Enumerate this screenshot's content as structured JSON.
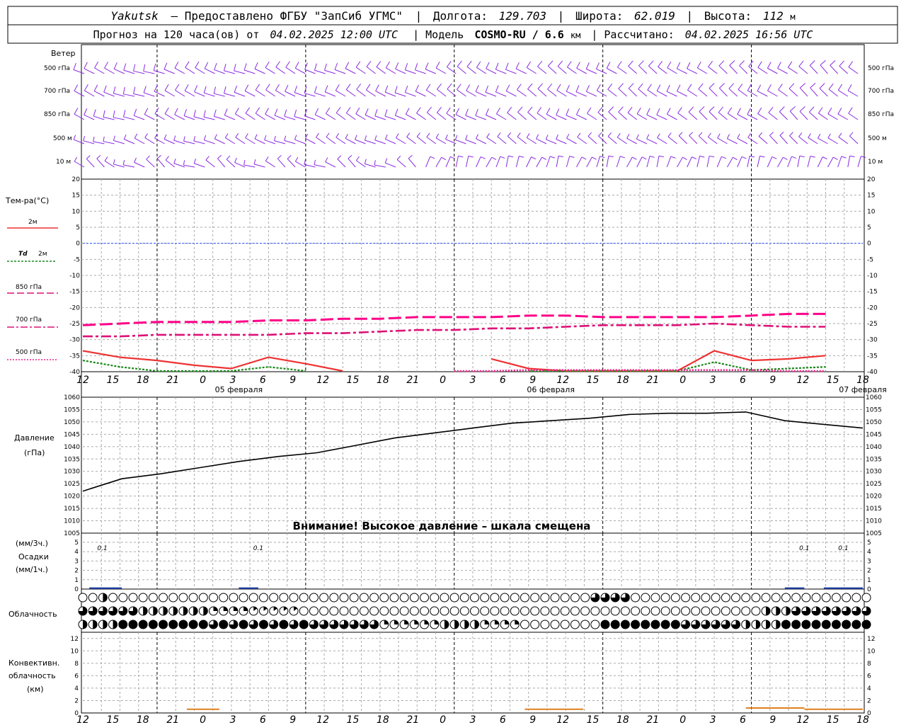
{
  "header": {
    "station": "Yakutsk",
    "provider": "— Предоставлено ФГБУ \"ЗапСиб УГМС\"",
    "lon_label": "Долгота:",
    "lon": "129.703",
    "lat_label": "Широта:",
    "lat": "62.019",
    "alt_label": "Высота:",
    "alt": "112",
    "alt_unit": "м",
    "line2_a": "Прогноз на 120 часа(ов) от",
    "run": "04.02.2025 12:00 UTC",
    "model_label": "| Модель",
    "model": "COSMO-RU / 6.6",
    "model_unit": "км",
    "calc_label": "| Рассчитано:",
    "calc": "04.02.2025 16:56 UTC"
  },
  "labels": {
    "wind": "Ветер",
    "temp": "Тем-ра(°С)",
    "t2m": "2м",
    "td": "Td",
    "td2m": "2м",
    "l850": "850 гПа",
    "l700": "700 гПа",
    "l500": "500 гПа",
    "pressure1": "Давление",
    "pressure2": "(гПа)",
    "precip1": "(мм/3ч.)",
    "precip2": "Осадки",
    "precip3": "(мм/1ч.)",
    "cloud": "Облачность",
    "conv1": "Конвективн.",
    "conv2": "облачность",
    "conv3": "(км)",
    "warning": "Внимание! Высокое давление – шкала смещена"
  },
  "colors": {
    "wind": "#8a2be2",
    "t2m": "#ee3333",
    "td": "#1a8a1a",
    "t850": "#ff0088",
    "t700": "#dd1177",
    "t500": "#ee2288",
    "zero": "#3355ff",
    "pressure": "#000000",
    "precip": "#1a3a9a",
    "conv": "#e08020"
  },
  "chart_data": [
    {
      "type": "line",
      "title": "Ветер",
      "levels": [
        "500 гПа",
        "700 гПа",
        "850 гПа",
        "500 м",
        "10 м"
      ]
    },
    {
      "type": "line",
      "ylabel": "Тем-ра(°С)",
      "ylim": [
        -40,
        20
      ],
      "yticks": [
        20,
        15,
        10,
        5,
        0,
        -5,
        -10,
        -15,
        -20,
        -25,
        -30,
        -35,
        -40
      ],
      "x_hours": [
        0,
        6,
        12,
        18,
        24,
        30,
        36,
        42,
        48,
        54,
        60,
        66,
        72,
        78,
        84,
        90,
        96,
        102,
        108,
        114,
        120
      ],
      "series": [
        {
          "name": "2м",
          "values": [
            -33.5,
            -35.5,
            -36.5,
            -38,
            -39,
            -35.5,
            -37.5,
            -40,
            null,
            null,
            null,
            -36,
            -39,
            -40,
            -40,
            -40,
            -40,
            -33.5,
            -36.5,
            -36,
            -35
          ]
        },
        {
          "name": "Td 2м",
          "values": [
            -36.5,
            -38.5,
            -40,
            -40,
            -40,
            -38.5,
            -40,
            null,
            null,
            null,
            null,
            null,
            -40,
            -40,
            -40,
            -40,
            -40,
            -37,
            -39.5,
            -39,
            -38.5
          ]
        },
        {
          "name": "850 гПа",
          "values": [
            -25.5,
            -25,
            -24.5,
            -24.5,
            -24.5,
            -24,
            -24,
            -23.5,
            -23.5,
            -23,
            -23,
            -23,
            -22.5,
            -22.5,
            -23,
            -23,
            -23,
            -23,
            -22.5,
            -22,
            -22
          ]
        },
        {
          "name": "700 гПа",
          "values": [
            -29,
            -29,
            -28.5,
            -28.5,
            -28.5,
            -28.5,
            -28,
            -28,
            -27.5,
            -27,
            -27,
            -26.5,
            -26.5,
            -26,
            -25.5,
            -25.5,
            -25.5,
            -25,
            -25.5,
            -26,
            -26
          ]
        },
        {
          "name": "500 гПа",
          "values": [
            null,
            null,
            null,
            null,
            null,
            null,
            null,
            null,
            null,
            null,
            -40,
            -40,
            -39.5,
            -39.5,
            -39.5,
            -39.5,
            -39.5,
            -39.5,
            -39.5,
            -40,
            -40
          ]
        }
      ]
    },
    {
      "type": "line",
      "ylabel": "Давление (гПа)",
      "ylim": [
        1005,
        1060
      ],
      "yticks": [
        1060,
        1055,
        1050,
        1045,
        1040,
        1035,
        1030,
        1025,
        1020,
        1015,
        1010,
        1005
      ],
      "x_hours": [
        0,
        6,
        12,
        18,
        24,
        30,
        36,
        42,
        48,
        54,
        60,
        66,
        72,
        78,
        84,
        90,
        96,
        102,
        108,
        114,
        120
      ],
      "series": [
        {
          "name": "Давление",
          "values": [
            1022,
            1027,
            1029,
            1031.5,
            1034,
            1036,
            1037.5,
            1040.5,
            1043.5,
            1045.5,
            1047.5,
            1049.5,
            1050.5,
            1051.5,
            1053,
            1053.5,
            1053.5,
            1054,
            1050.5,
            1049,
            1047.5
          ]
        }
      ]
    },
    {
      "type": "bar",
      "ylabel": "Осадки",
      "ylim": [
        0,
        5
      ],
      "yticks": [
        5,
        4,
        3,
        2,
        1,
        0
      ],
      "annotations": [
        {
          "hour": 3,
          "text": "0.1"
        },
        {
          "hour": 27,
          "text": "0.1"
        },
        {
          "hour": 111,
          "text": "0.1"
        },
        {
          "hour": 117,
          "text": "0.1"
        }
      ],
      "bars": [
        {
          "hour_start": 1,
          "hour_end": 6,
          "value": 0.1
        },
        {
          "hour_start": 24,
          "hour_end": 27,
          "value": 0.1
        },
        {
          "hour_start": 108,
          "hour_end": 111,
          "value": 0.1
        },
        {
          "hour_start": 114,
          "hour_end": 120,
          "value": 0.1
        }
      ]
    },
    {
      "type": "table",
      "title": "Облачность",
      "rows": [
        "upper",
        "middle",
        "low"
      ]
    },
    {
      "type": "area",
      "ylabel": "Конвективн. облачность (км)",
      "ylim": [
        0,
        13
      ],
      "yticks": [
        12,
        10,
        8,
        6,
        4,
        2,
        0
      ],
      "segments": [
        {
          "hour_start": 16,
          "hour_end": 21,
          "value": 0.6
        },
        {
          "hour_start": 68,
          "hour_end": 77,
          "value": 0.6
        },
        {
          "hour_start": 102,
          "hour_end": 111,
          "value": 0.8
        },
        {
          "hour_start": 111,
          "hour_end": 120,
          "value": 0.6
        }
      ]
    }
  ],
  "x_axis": {
    "hour_labels": [
      "12",
      "15",
      "18",
      "21",
      "0",
      "3",
      "6",
      "9",
      "12",
      "15",
      "18",
      "21",
      "0",
      "3",
      "6",
      "9",
      "12",
      "15",
      "18",
      "21",
      "0",
      "3",
      "6",
      "9",
      "12",
      "15",
      "18"
    ],
    "dates": [
      {
        "label": "05 февраля",
        "hour": 24
      },
      {
        "label": "06 февраля",
        "hour": 72
      },
      {
        "label": "07 февраля",
        "hour": 120
      }
    ]
  }
}
